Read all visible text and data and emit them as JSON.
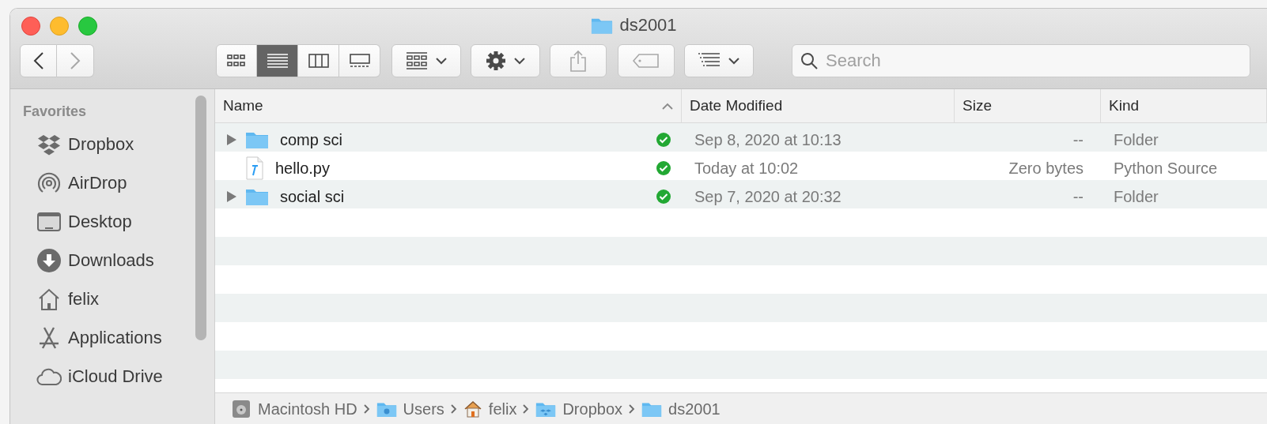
{
  "window": {
    "title": "ds2001"
  },
  "toolbar": {
    "nav": [
      {
        "kind": "back",
        "disabled": false
      },
      {
        "kind": "forward",
        "disabled": true
      }
    ],
    "view_modes": [
      {
        "kind": "icons",
        "selected": false
      },
      {
        "kind": "list",
        "selected": true
      },
      {
        "kind": "columns",
        "selected": false
      },
      {
        "kind": "gallery",
        "selected": false
      }
    ],
    "buttons": [
      {
        "kind": "group",
        "disabled": false
      },
      {
        "kind": "action",
        "disabled": false
      },
      {
        "kind": "share",
        "disabled": true
      },
      {
        "kind": "tag",
        "disabled": true
      },
      {
        "kind": "sort",
        "disabled": false
      }
    ],
    "search": {
      "placeholder": "Search"
    }
  },
  "sidebar": {
    "section": "Favorites",
    "items": [
      {
        "label": "Dropbox",
        "kind": "dropbox"
      },
      {
        "label": "AirDrop",
        "kind": "airdrop"
      },
      {
        "label": "Desktop",
        "kind": "desktop"
      },
      {
        "label": "Downloads",
        "kind": "downloads"
      },
      {
        "label": "felix",
        "kind": "home"
      },
      {
        "label": "Applications",
        "kind": "applications"
      },
      {
        "label": "iCloud Drive",
        "kind": "cloud"
      }
    ]
  },
  "table": {
    "columns": [
      {
        "label": "Name",
        "sorted": true
      },
      {
        "label": "Date Modified",
        "sorted": false
      },
      {
        "label": "Size",
        "sorted": false
      },
      {
        "label": "Kind",
        "sorted": false
      }
    ],
    "rows": [
      {
        "kind": "folder",
        "expandable": true,
        "synced": true,
        "cells": [
          "comp sci",
          "Sep 8, 2020 at 10:13",
          "--",
          "Folder"
        ]
      },
      {
        "kind": "python",
        "expandable": false,
        "synced": true,
        "cells": [
          "hello.py",
          "Today at 10:02",
          "Zero bytes",
          "Python Source"
        ]
      },
      {
        "kind": "folder",
        "expandable": true,
        "synced": true,
        "cells": [
          "social sci",
          "Sep 7, 2020 at 20:32",
          "--",
          "Folder"
        ]
      }
    ]
  },
  "path_bar": [
    {
      "label": "Macintosh HD",
      "kind": "disk"
    },
    {
      "label": "Users",
      "kind": "users"
    },
    {
      "label": "felix",
      "kind": "home"
    },
    {
      "label": "Dropbox",
      "kind": "dropbox"
    },
    {
      "label": "ds2001",
      "kind": "folder"
    }
  ]
}
